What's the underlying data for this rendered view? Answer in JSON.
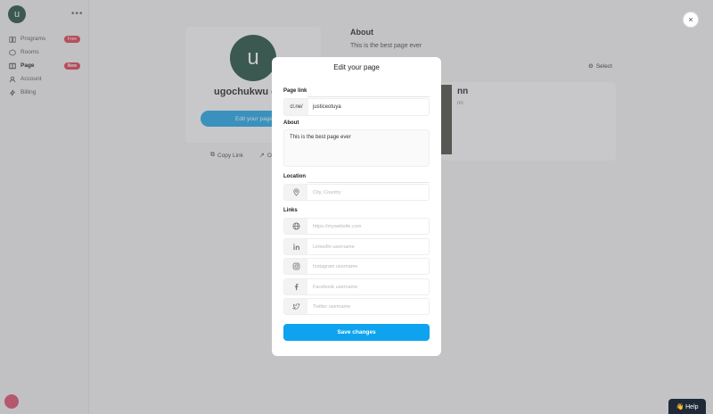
{
  "sidebar": {
    "user_initial": "u",
    "menu_dots": "•••",
    "items": [
      {
        "label": "Programs",
        "badge": "Free",
        "icon": "book-icon"
      },
      {
        "label": "Rooms",
        "badge": "",
        "icon": "hexagon-icon"
      },
      {
        "label": "Page",
        "badge": "New",
        "icon": "columns-icon"
      },
      {
        "label": "Account",
        "badge": "",
        "icon": "user-icon"
      },
      {
        "label": "Billing",
        "badge": "",
        "icon": "lightning-icon"
      }
    ]
  },
  "profile": {
    "initial": "u",
    "name": "ugochukwu o",
    "edit_button": "Edit your page",
    "copy_link": "Copy Link",
    "open_link": "O"
  },
  "about": {
    "title": "About",
    "text": "This is the best page ever",
    "select_label": "Select"
  },
  "program_card": {
    "title": "nn",
    "subtitle": "nn"
  },
  "modal": {
    "title": "Edit your page",
    "page_link_label": "Page link",
    "link_prefix": "cl.ne/",
    "link_value": "justiceotuya",
    "about_label": "About",
    "about_value": "This is the best page ever",
    "location_label": "Location",
    "location_placeholder": "City, Country",
    "links_label": "Links",
    "links": [
      {
        "icon": "globe-icon",
        "placeholder": "https://mywebsite.com"
      },
      {
        "icon": "linkedin-icon",
        "placeholder": "LinkedIn username"
      },
      {
        "icon": "instagram-icon",
        "placeholder": "Instagram username"
      },
      {
        "icon": "facebook-icon",
        "placeholder": "Facebook username"
      },
      {
        "icon": "twitter-icon",
        "placeholder": "Twitter username"
      }
    ],
    "save_button": "Save changes"
  },
  "help_button": "👋 Help",
  "close_icon": "×",
  "colors": {
    "accent": "#0ea3ee",
    "avatar": "#1c4b3c",
    "badge": "#e23b4e"
  }
}
